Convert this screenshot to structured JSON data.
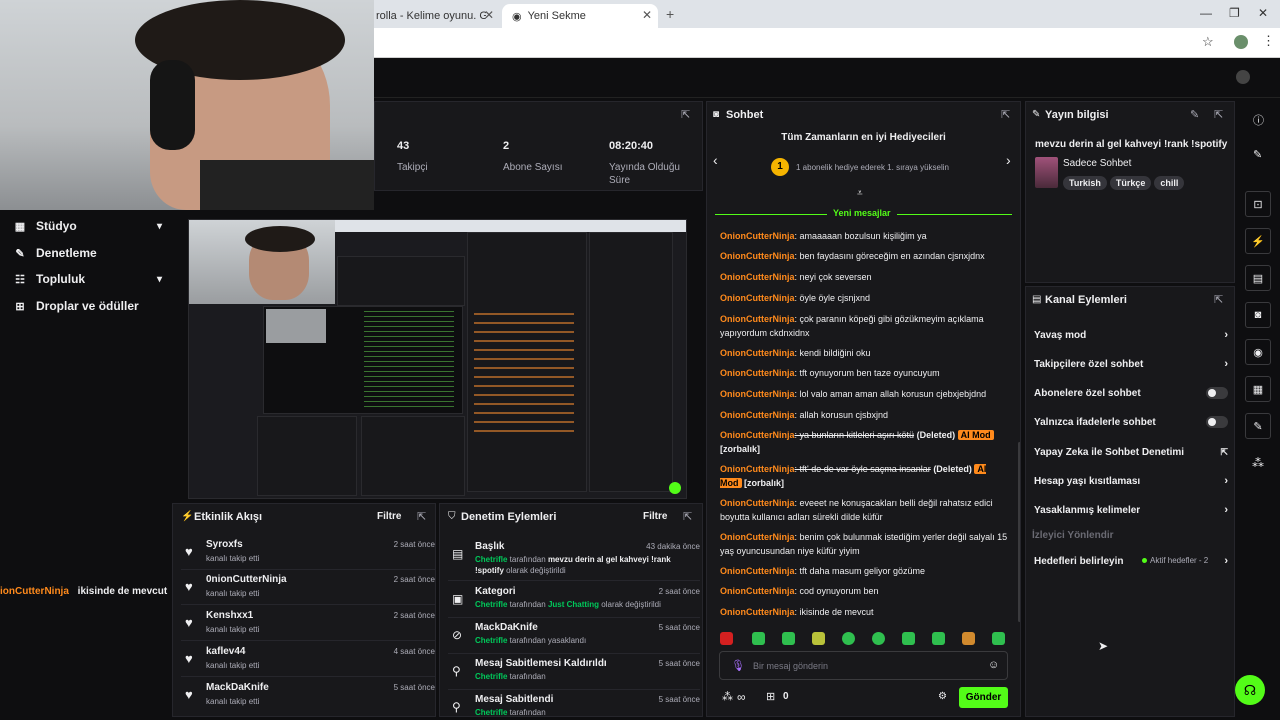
{
  "browser": {
    "tab1": "rolla - Kelime oyunu. Günlük",
    "tab2": "Yeni Sekme",
    "new_tab": "+",
    "minimize": "—",
    "maximize": "❐",
    "close": "✕"
  },
  "stats": {
    "followers_value": "43",
    "followers_label": "Takipçi",
    "subs_value": "2",
    "subs_label": "Abone Sayısı",
    "uptime_value": "08:20:40",
    "uptime_label": "Yayında Olduğu Süre"
  },
  "sidebar": {
    "items": [
      {
        "label": "Stüdyo",
        "icon": "studio-icon"
      },
      {
        "label": "Denetleme",
        "icon": "wrench-icon"
      },
      {
        "label": "Topluluk",
        "icon": "community-icon"
      },
      {
        "label": "Droplar ve ödüller",
        "icon": "gift-icon"
      }
    ]
  },
  "overlay_chat": {
    "user": "ionCutterNinja",
    "text": "ikisinde de mevcut"
  },
  "activity": {
    "title": "Etkinlik Akışı",
    "filter": "Filtre",
    "items": [
      {
        "name": "Syroxfs",
        "sub": "kanalı takip etti",
        "time": "2 saat önce"
      },
      {
        "name": "0nionCutterNinja",
        "sub": "kanalı takip etti",
        "time": "2 saat önce"
      },
      {
        "name": "Kenshxx1",
        "sub": "kanalı takip etti",
        "time": "2 saat önce"
      },
      {
        "name": "kaflev44",
        "sub": "kanalı takip etti",
        "time": "4 saat önce"
      },
      {
        "name": "MackDaKnife",
        "sub": "kanalı takip etti",
        "time": "5 saat önce"
      }
    ]
  },
  "mod_actions": {
    "title": "Denetim Eylemleri",
    "filter": "Filtre",
    "items": [
      {
        "title": "Başlık",
        "time": "43 dakika önce",
        "actor": "Chetrifle",
        "mid": " tarafından ",
        "value": "mevzu derin al gel kahveyi !rank !spotify",
        "tail": " olarak değiştirildi"
      },
      {
        "title": "Kategori",
        "time": "2 saat önce",
        "actor": "Chetrifle",
        "mid": " tarafından ",
        "value": "Just Chatting",
        "tail": " olarak değiştirildi"
      },
      {
        "title": "MackDaKnife",
        "time": "5 saat önce",
        "actor": "Chetrifle",
        "mid": " tarafından yasaklandı",
        "value": "",
        "tail": ""
      },
      {
        "title": "Mesaj Sabitlemesi Kaldırıldı",
        "time": "5 saat önce",
        "actor": "Chetrifle",
        "mid": " tarafından",
        "value": "",
        "tail": ""
      },
      {
        "title": "Mesaj Sabitlendi",
        "time": "5 saat önce",
        "actor": "Chetrifle",
        "mid": " tarafından",
        "value": "",
        "tail": ""
      }
    ]
  },
  "chat": {
    "title": "Sohbet",
    "leaderboard_title": "Tüm Zamanların en iyi Hediyecileri",
    "leaderboard_rank": "1",
    "leaderboard_text": "1 abonelik hediye ederek 1. sıraya yükselin",
    "new_messages": "Yeni mesajlar",
    "messages": [
      {
        "user": "OnionCutterNinja",
        "text": ": amaaaaan bozulsun kişiliğim ya"
      },
      {
        "user": "OnionCutterNinja",
        "text": ": ben faydasını göreceğim en azından cjsnxjdnx"
      },
      {
        "user": "OnionCutterNinja",
        "text": ": neyi çok seversen"
      },
      {
        "user": "OnionCutterNinja",
        "text": ": öyle öyle cjsnjxnd"
      },
      {
        "user": "OnionCutterNinja",
        "text": ": çok paranın köpeği gibi gözükmeyim açıklama yapıyordum ckdnxidnx"
      },
      {
        "user": "OnionCutterNinja",
        "text": ": kendi bildiğini oku"
      },
      {
        "user": "OnionCutterNinja",
        "text": ": tft oynuyorum ben taze oyuncuyum"
      },
      {
        "user": "OnionCutterNinja",
        "text": ": lol valo aman aman allah korusun cjebxjebjdnd"
      },
      {
        "user": "OnionCutterNinja",
        "text": ": allah korusun cjsbxjnd"
      },
      {
        "user": "OnionCutterNinja",
        "text": ": ya bunların kitleleri aşırı kötü",
        "deleted": "(Deleted)",
        "badge": "AI Mod",
        "tag": "[zorbalık]"
      },
      {
        "user": "OnionCutterNinja",
        "text": ": tft' de de var öyle saçma insanlar",
        "deleted": "(Deleted)",
        "badge": "AI Mod",
        "tag": "[zorbalık]"
      },
      {
        "user": "OnionCutterNinja",
        "text": ": eveeet ne konuşacakları belli değil rahatsız edici boyutta kullanıcı adları sürekli dilde küfür"
      },
      {
        "user": "OnionCutterNinja",
        "text": ": benim çok bulunmak istediğim yerler değil salyalı 15 yaş oyuncusundan niye küfür yiyim"
      },
      {
        "user": "OnionCutterNinja",
        "text": ": tft daha masum geliyor gözüme"
      },
      {
        "user": "OnionCutterNinja",
        "text": ": cod oynuyorum ben"
      },
      {
        "user": "OnionCutterNinja",
        "text": ": ikisinde de mevcut"
      }
    ],
    "input_placeholder": "Bir mesaj gönderin",
    "points": "∞",
    "gift_count": "0",
    "send": "Gönder"
  },
  "stream_info": {
    "title": "Yayın bilgisi",
    "stream_title": "mevzu derin al gel kahveyi !rank !spotify",
    "category": "Sadece Sohbet",
    "tags": [
      "Turkish",
      "Türkçe",
      "chill"
    ]
  },
  "channel_actions": {
    "title": "Kanal Eylemleri",
    "items": [
      {
        "label": "Yavaş mod",
        "control": "chevron"
      },
      {
        "label": "Takipçilere özel sohbet",
        "control": "chevron"
      },
      {
        "label": "Abonelere özel sohbet",
        "control": "toggle"
      },
      {
        "label": "Yalnızca ifadelerle sohbet",
        "control": "toggle"
      },
      {
        "label": "Yapay Zeka ile Sohbet Denetimi",
        "control": "external"
      },
      {
        "label": "Hesap yaşı kısıtlaması",
        "control": "chevron"
      },
      {
        "label": "Yasaklanmış kelimeler",
        "control": "chevron"
      }
    ],
    "viewer_directions": "İzleyici Yönlendir",
    "goals_label": "Hedefleri belirleyin",
    "goals_status": "Aktif hedefler - 2"
  },
  "colors": {
    "accent": "#53fc18",
    "username": "#ff8a1c",
    "mod_actor": "#53fc18"
  }
}
